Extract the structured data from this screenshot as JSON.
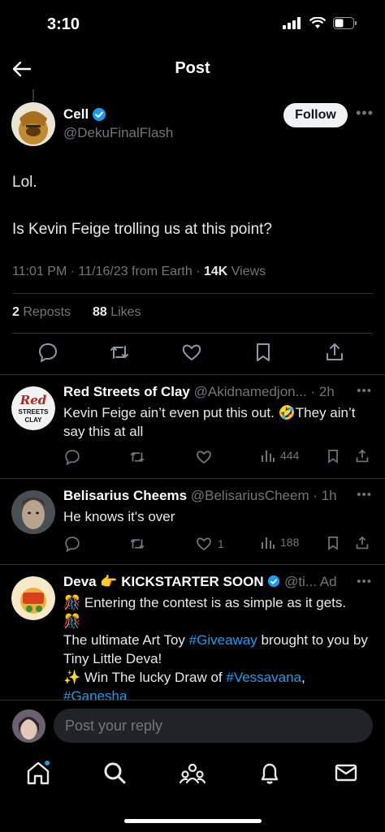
{
  "status_bar": {
    "time": "3:10"
  },
  "header": {
    "title": "Post"
  },
  "post": {
    "author_name": "Cell",
    "author_handle": "@DekuFinalFlash",
    "follow_label": "Follow",
    "text_line1": "Lol.",
    "text_line2": "Is Kevin Feige trolling us at this point?",
    "meta_prefix": "11:01 PM · 11/16/23 from Earth · ",
    "views_count": "14K",
    "views_label": " Views",
    "reposts_count": "2",
    "reposts_label": " Reposts",
    "likes_count": "88",
    "likes_label": " Likes"
  },
  "replies": [
    {
      "name": "Red Streets of Clay",
      "meta": " @Akidnamedjon... · 2h",
      "text": "Kevin Feige ain’t even put this out. 🤣They ain’t say this at all",
      "likes": "",
      "views": "444",
      "avatar_text_1": "Red",
      "avatar_text_2": "STREETS",
      "avatar_text_3": "CLAY"
    },
    {
      "name": "Belisarius Cheems",
      "meta": " @BelisariusCheem · 1h",
      "text": "He knows it's over",
      "likes": "1",
      "views": "188"
    }
  ],
  "ad": {
    "name": "Deva 👉 KICKSTARTER SOON",
    "meta": " @ti... ",
    "ad_label": "Ad",
    "line1": "🎊 Entering the contest is as simple as it gets.",
    "line2": "🎊",
    "line3_prefix": "The ultimate Art Toy ",
    "hashtag1": "#Giveaway",
    "line3_suffix": " brought to you by Tiny Little Deva!",
    "line4_prefix": "✨  Win The lucky Draw of ",
    "hashtag2": "#Vessavana",
    "line4_suffix": ",",
    "hashtag3": "#Ganesha"
  },
  "reply_bar": {
    "placeholder": "Post your reply"
  },
  "colors": {
    "accent": "#1d9bf0",
    "background": "#000000",
    "muted": "#71767b"
  },
  "icons": [
    "back-arrow-icon",
    "verified-badge-icon",
    "reply-icon",
    "repost-icon",
    "like-icon",
    "bookmark-icon",
    "share-icon",
    "views-icon",
    "home-icon",
    "search-icon",
    "communities-icon",
    "notifications-icon",
    "messages-icon"
  ]
}
